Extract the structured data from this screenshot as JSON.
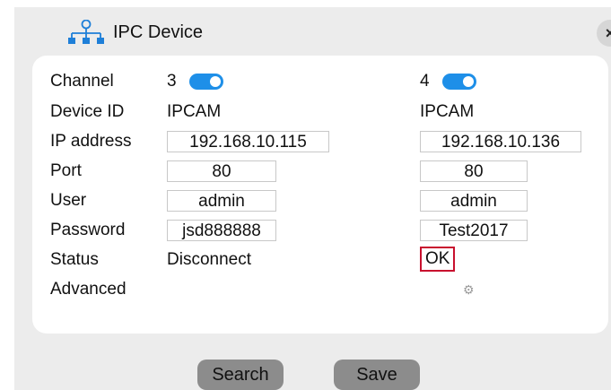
{
  "title": "IPC Device",
  "close_label": "×",
  "labels": {
    "channel": "Channel",
    "device_id": "Device ID",
    "ip_address": "IP address",
    "port": "Port",
    "user": "User",
    "password": "Password",
    "status": "Status",
    "advanced": "Advanced"
  },
  "devices": [
    {
      "channel": "3",
      "enabled": true,
      "device_id": "IPCAM",
      "ip_address": "192.168.10.115",
      "port": "80",
      "user": "admin",
      "password": "jsd888888",
      "status": "Disconnect"
    },
    {
      "channel": "4",
      "enabled": true,
      "device_id": "IPCAM",
      "ip_address": "192.168.10.136",
      "port": "80",
      "user": "admin",
      "password": "Test2017",
      "status": "OK",
      "advanced_icon": "gear-icon"
    }
  ],
  "buttons": {
    "search": "Search",
    "save": "Save"
  },
  "colors": {
    "toggle_on": "#1e8fe8",
    "status_ok_border": "#c8102e"
  }
}
